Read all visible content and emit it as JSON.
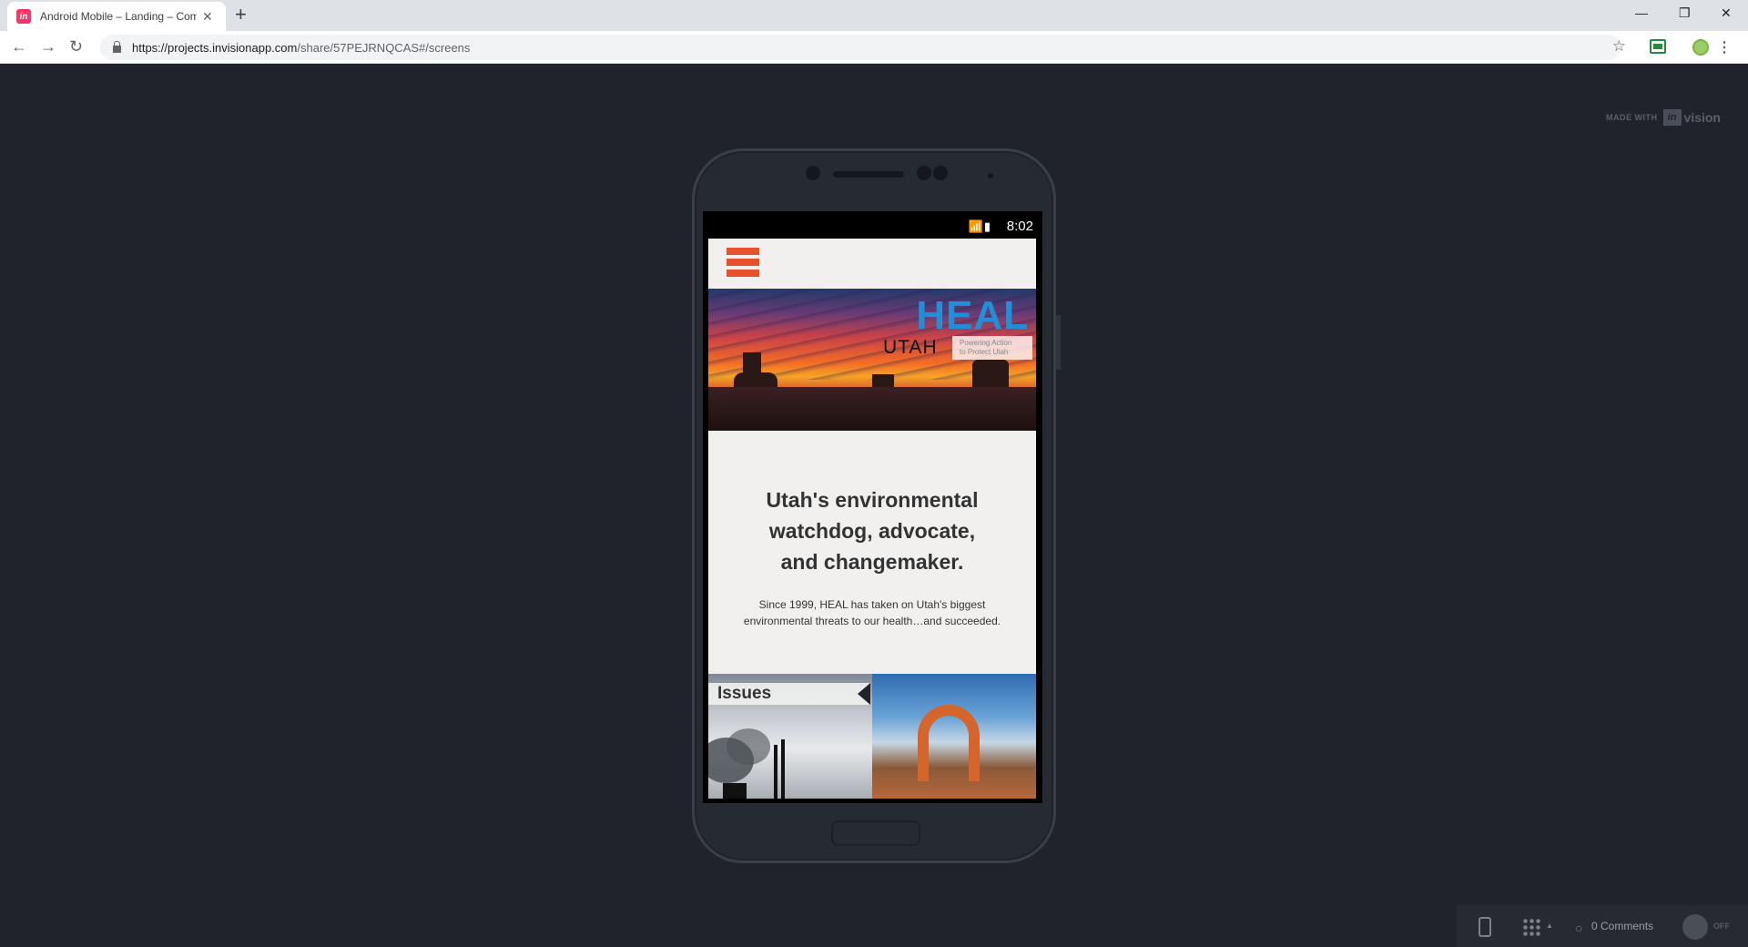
{
  "browser": {
    "tab_title": "Android Mobile – Landing – Com",
    "favicon_text": "in",
    "new_tab_label": "+",
    "close_label": "✕",
    "minimize_label": "—",
    "restore_label": "❐",
    "window_close_label": "✕",
    "back_label": "←",
    "forward_label": "→",
    "reload_label": "↻",
    "url_domain": "https://projects.invisionapp.com",
    "url_path": "/share/57PEJRNQCAS#/screens",
    "star_label": "☆",
    "menu_label": "⋮"
  },
  "invision": {
    "made_with": "MADE WITH",
    "logo_box": "in",
    "logo_word": "vision",
    "comments": "0 Comments",
    "toggle_state": "OFF",
    "caret": "▲"
  },
  "phone": {
    "status_time": "8:02",
    "status_icons": "📶▮"
  },
  "app": {
    "heal": "HEAL",
    "utah": "UTAH",
    "tagline_line1": "Powering Action",
    "tagline_line2": "to Protect Utah",
    "headline_line1": "Utah's environmental",
    "headline_line2": "watchdog, advocate,",
    "headline_line3": "and changemaker.",
    "subtext_line1": "Since 1999, HEAL has taken on Utah's biggest",
    "subtext_line2": "environmental threats to our health…and succeeded.",
    "issues_label": "Issues"
  },
  "colors": {
    "accent_orange": "#e8512b",
    "heal_blue": "#1f8fd8",
    "stage_bg": "#20232b"
  }
}
